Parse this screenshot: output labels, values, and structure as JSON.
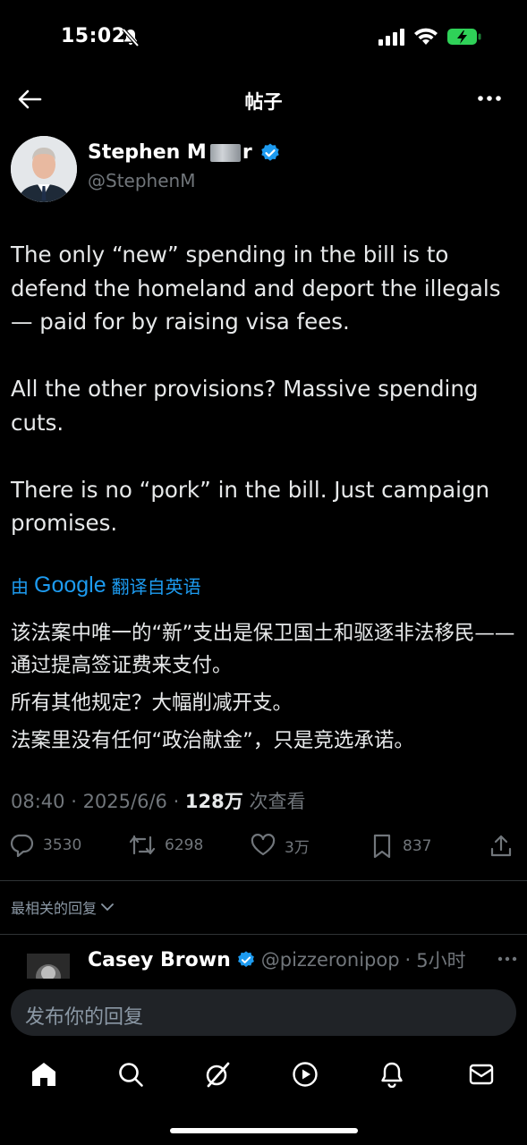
{
  "status_bar": {
    "time": "15:02"
  },
  "header": {
    "title": "帖子"
  },
  "tweet": {
    "author_name": "Stephen M",
    "author_name_suffix": "r",
    "handle": "@StephenM",
    "text": "The only “new” spending in the bill is to defend the homeland and deport the illegals — paid for by raising visa fees.\n\nAll the other provisions? Massive spending cuts.\n\nThere is no “pork” in the bill. Just campaign promises.",
    "translated_prefix": "由",
    "translated_brand": "Google",
    "translated_suffix": "翻译自英语",
    "translation": [
      "该法案中唯一的“新”支出是保卫国土和驱逐非法移民——通过提高签证费来支付。",
      "所有其他规定？大幅削减开支。",
      "法案里没有任何“政治献金”，只是竞选承诺。"
    ],
    "time": "08:40",
    "date": "2025/6/6",
    "views": "128万",
    "views_label": "次查看",
    "actions": {
      "replies": "3530",
      "reposts": "6298",
      "likes": "3万",
      "bookmarks": "837"
    }
  },
  "replies": {
    "sort_label": "最相关的回复",
    "first": {
      "name": "Casey Brown",
      "handle": "@pizzeronipop",
      "time": "5小时"
    }
  },
  "compose": {
    "placeholder": "发布你的回复"
  },
  "colors": {
    "accent": "#1d9bf0",
    "muted": "#71767b",
    "background": "#000000"
  }
}
